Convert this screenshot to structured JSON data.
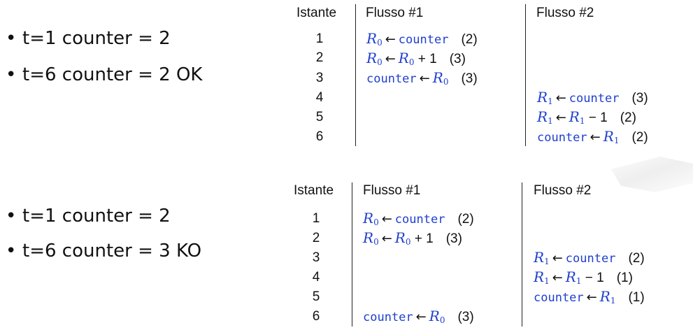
{
  "top": {
    "bullets": [
      "t=1 counter = 2",
      "t=6 counter = 2 OK"
    ],
    "headers": {
      "istante": "Istante",
      "flusso1": "Flusso #1",
      "flusso2": "Flusso #2"
    },
    "times": [
      "1",
      "2",
      "3",
      "4",
      "5",
      "6"
    ],
    "flusso1": {
      "r0_counter_count": "(2)",
      "r0_inc_count": "(3)",
      "counter_r0_count": "(3)"
    },
    "flusso2": {
      "r1_counter_count": "(3)",
      "r1_dec_count": "(2)",
      "counter_r1_count": "(2)"
    }
  },
  "bottom": {
    "bullets": [
      "t=1 counter = 2",
      "t=6 counter = 3  KO"
    ],
    "headers": {
      "istante": "Istante",
      "flusso1": "Flusso #1",
      "flusso2": "Flusso #2"
    },
    "times": [
      "1",
      "2",
      "3",
      "4",
      "5",
      "6"
    ],
    "flusso1": {
      "r0_counter_count": "(2)",
      "r0_inc_count": "(3)",
      "counter_r0_count": "(3)"
    },
    "flusso2": {
      "r1_counter_count": "(2)",
      "r1_dec_count": "(1)",
      "counter_r1_count": "(1)"
    }
  },
  "symbols": {
    "reg0": "R",
    "reg1": "R",
    "sub0": "0",
    "sub1": "1",
    "arrow": "←",
    "counter": "counter",
    "plus_one": "+ 1",
    "minus_one": "− 1",
    "bullet": "•"
  }
}
